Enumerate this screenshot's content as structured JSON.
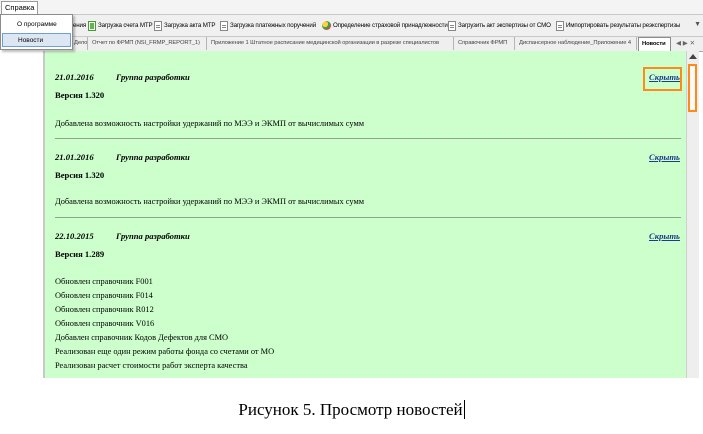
{
  "menubar": {
    "menu_label": "Справка"
  },
  "dropdown": {
    "items": [
      "О программе",
      "Новости"
    ]
  },
  "toolbar": {
    "items": [
      "ения",
      "Загрузка счета МТР",
      "Загрузка акта МТР",
      "Загрузка платежных поручений",
      "Определение страховой принадлежности",
      "Загрузить акт экспертизы от СМО",
      "Импортировать результаты реэкспертизы"
    ],
    "scroll_glyph": "▼"
  },
  "tabs": {
    "items": [
      "Дело",
      "Отчет по ФРМП (NSI_FRMP_REPORT_1)",
      "Приложение 1 Штатное расписание медицинской организации в разрезе специалистов",
      "Справочник ФРМП",
      "Диспансерное наблюдение_Приложение 4",
      "Новости"
    ],
    "nav": "◀ ▶ ✕"
  },
  "news": [
    {
      "date": "21.01.2016",
      "group": "Группа разработки",
      "version": "Версия 1.320",
      "lines": [
        "Добавлена возможность настройки удержаний по МЭЭ и ЭКМП от вычислимых сумм"
      ],
      "hide_label": "Скрыть"
    },
    {
      "date": "21.01.2016",
      "group": "Группа разработки",
      "version": "Версия 1.320",
      "lines": [
        "Добавлена возможность настройки удержаний по МЭЭ и ЭКМП от вычислимых сумм"
      ],
      "hide_label": "Скрыть"
    },
    {
      "date": "22.10.2015",
      "group": "Группа разработки",
      "version": "Версия 1.289",
      "lines": [
        "Обновлен справочник F001",
        "Обновлен справочник F014",
        "Обновлен справочник R012",
        "Обновлен справочник V016",
        "Добавлен справочник Кодов Дефектов для СМО",
        "Реализован еще один режим работы фонда со счетами от МО",
        "Реализован расчет стоимости работ эксперта качества"
      ],
      "hide_label": "Скрыть"
    }
  ],
  "caption": "Рисунок 5. Просмотр новостей",
  "colors": {
    "content_bg": "#ccffcc",
    "highlight": "#ff8a1a",
    "link": "#1f3a8a"
  }
}
